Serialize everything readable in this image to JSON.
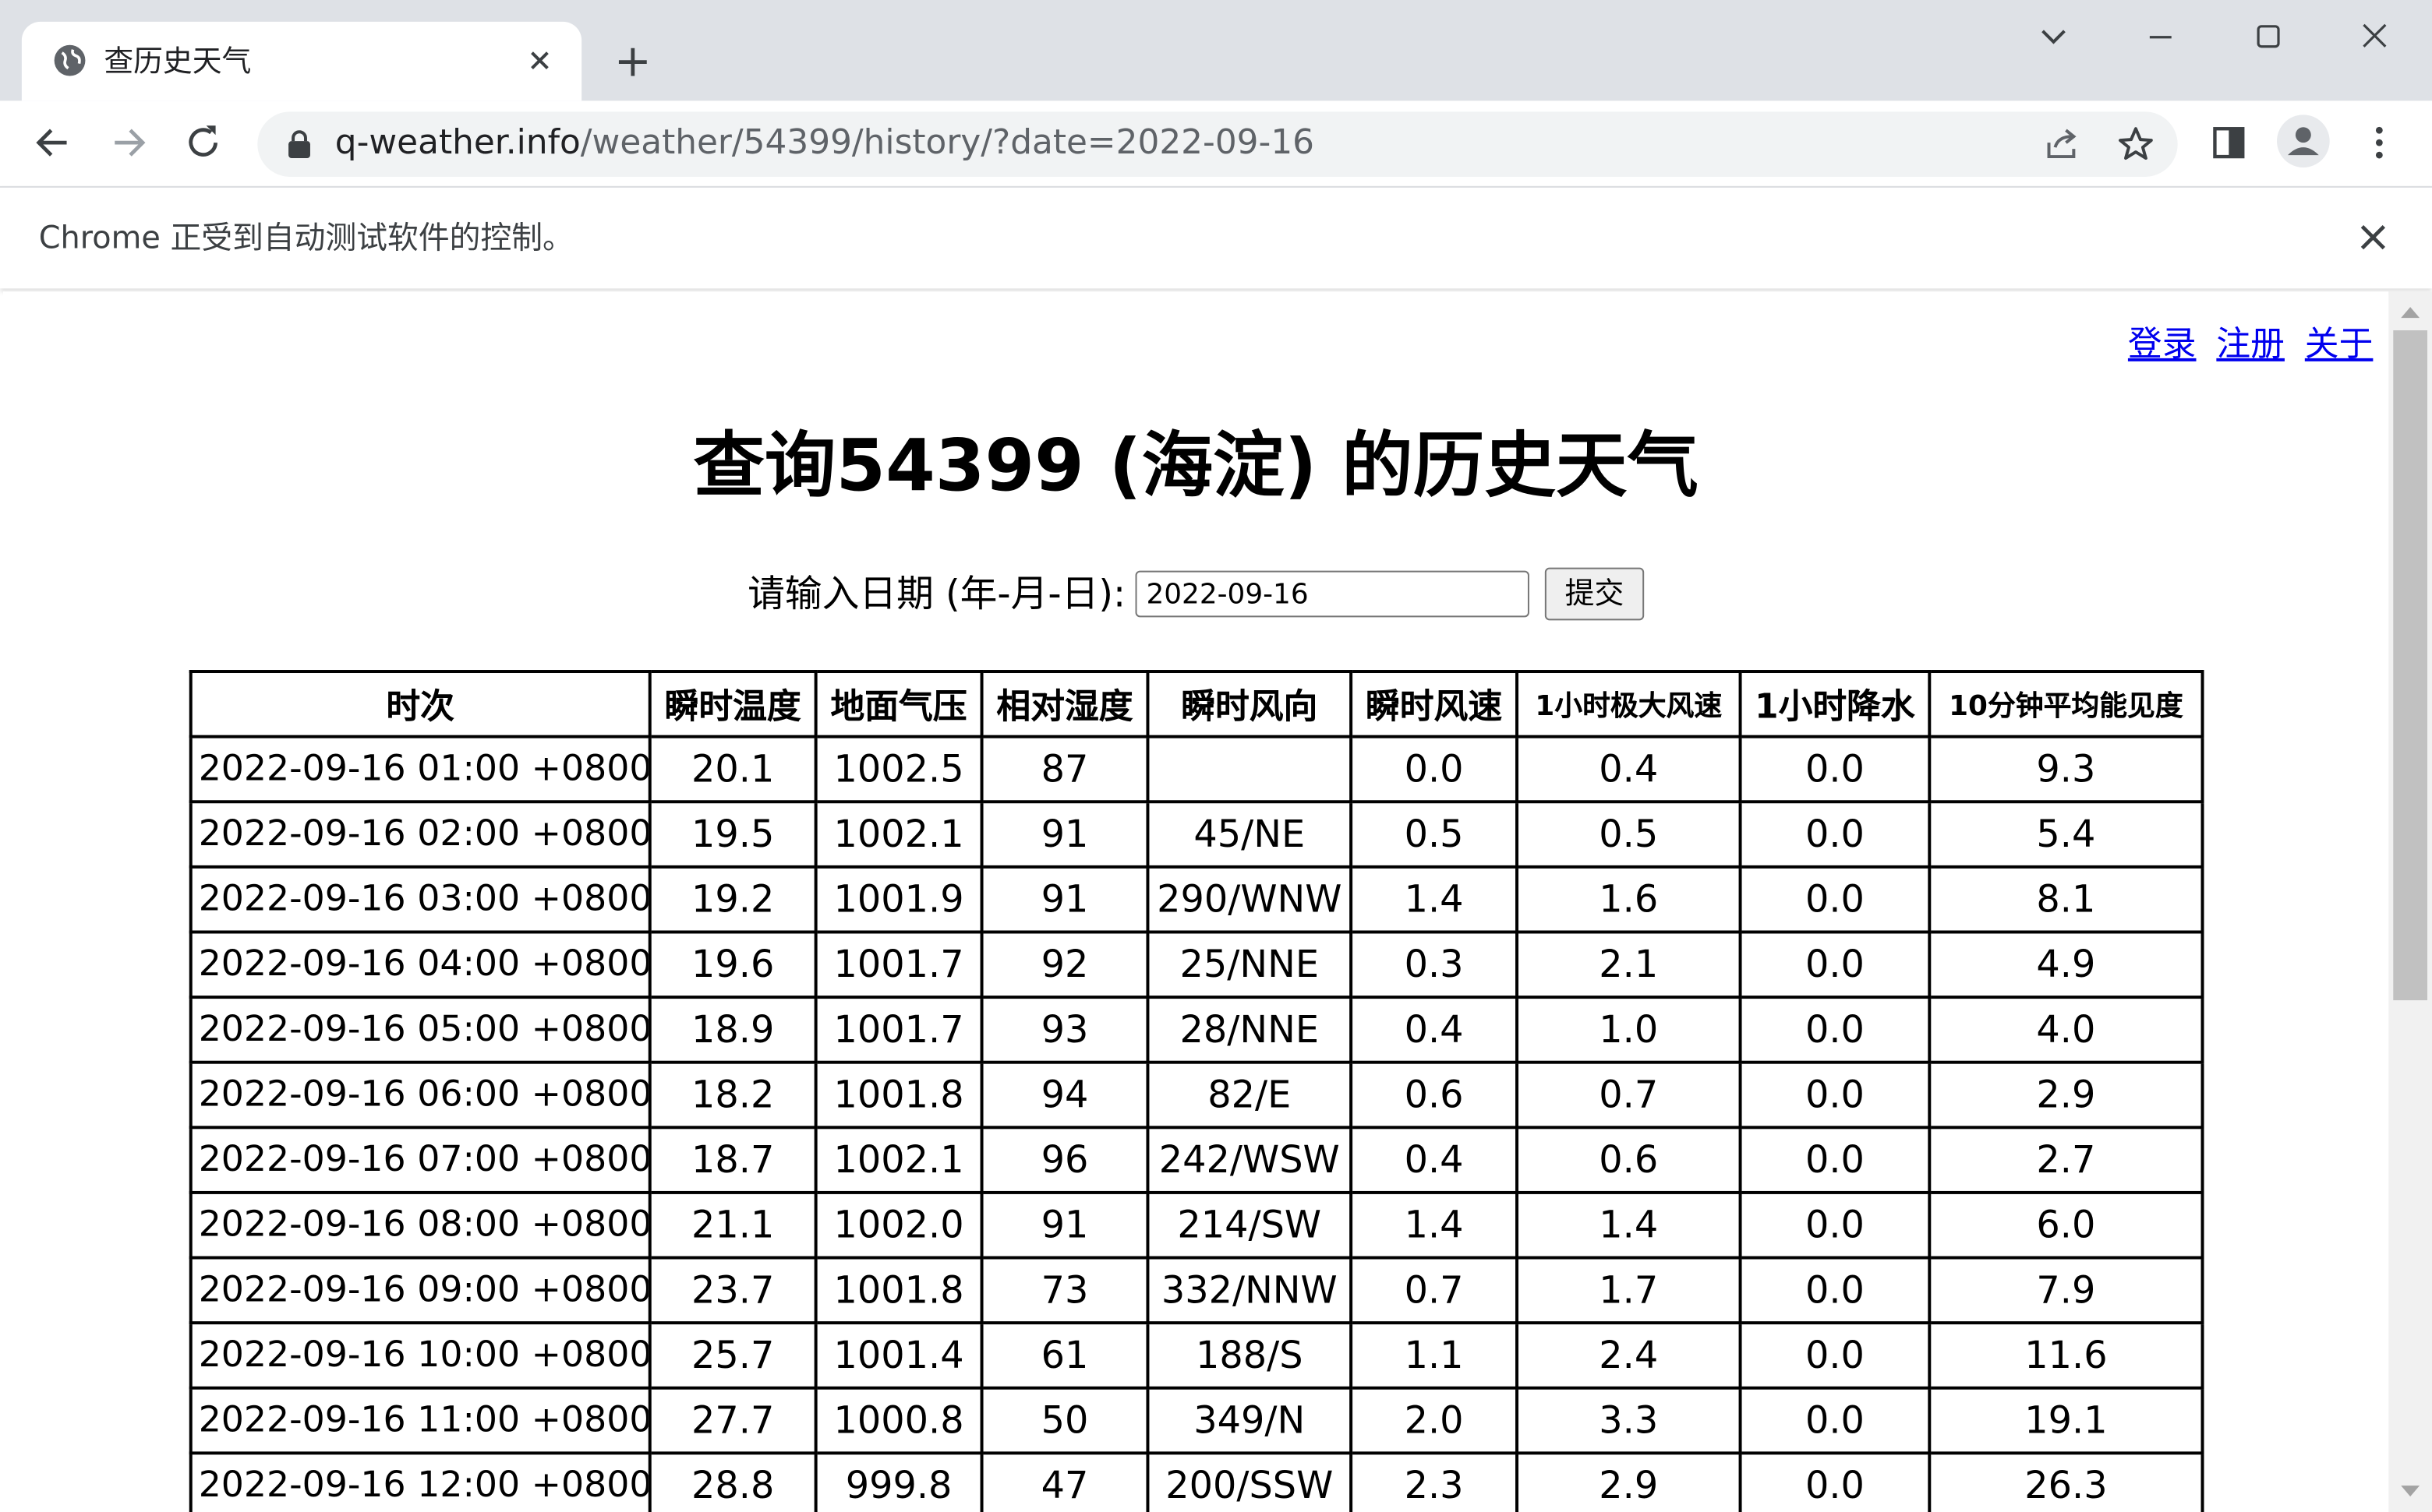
{
  "browser": {
    "tab_title": "查历史天气",
    "url_host": "q-weather.info",
    "url_path": "/weather/54399/history/?date=2022-09-16",
    "infobar_text": "Chrome 正受到自动测试软件的控制。"
  },
  "page": {
    "links": {
      "login": "登录",
      "register": "注册",
      "about": "关于"
    },
    "title": "查询54399 (海淀) 的历史天气",
    "form": {
      "label": "请输入日期 (年-月-日):",
      "date_value": "2022-09-16",
      "submit_label": "提交"
    },
    "table": {
      "headers": [
        "时次",
        "瞬时温度",
        "地面气压",
        "相对湿度",
        "瞬时风向",
        "瞬时风速",
        "1小时极大风速",
        "1小时降水",
        "10分钟平均能见度"
      ],
      "rows": [
        [
          "2022-09-16 01:00 +0800",
          "20.1",
          "1002.5",
          "87",
          "",
          "0.0",
          "0.4",
          "0.0",
          "9.3"
        ],
        [
          "2022-09-16 02:00 +0800",
          "19.5",
          "1002.1",
          "91",
          "45/NE",
          "0.5",
          "0.5",
          "0.0",
          "5.4"
        ],
        [
          "2022-09-16 03:00 +0800",
          "19.2",
          "1001.9",
          "91",
          "290/WNW",
          "1.4",
          "1.6",
          "0.0",
          "8.1"
        ],
        [
          "2022-09-16 04:00 +0800",
          "19.6",
          "1001.7",
          "92",
          "25/NNE",
          "0.3",
          "2.1",
          "0.0",
          "4.9"
        ],
        [
          "2022-09-16 05:00 +0800",
          "18.9",
          "1001.7",
          "93",
          "28/NNE",
          "0.4",
          "1.0",
          "0.0",
          "4.0"
        ],
        [
          "2022-09-16 06:00 +0800",
          "18.2",
          "1001.8",
          "94",
          "82/E",
          "0.6",
          "0.7",
          "0.0",
          "2.9"
        ],
        [
          "2022-09-16 07:00 +0800",
          "18.7",
          "1002.1",
          "96",
          "242/WSW",
          "0.4",
          "0.6",
          "0.0",
          "2.7"
        ],
        [
          "2022-09-16 08:00 +0800",
          "21.1",
          "1002.0",
          "91",
          "214/SW",
          "1.4",
          "1.4",
          "0.0",
          "6.0"
        ],
        [
          "2022-09-16 09:00 +0800",
          "23.7",
          "1001.8",
          "73",
          "332/NNW",
          "0.7",
          "1.7",
          "0.0",
          "7.9"
        ],
        [
          "2022-09-16 10:00 +0800",
          "25.7",
          "1001.4",
          "61",
          "188/S",
          "1.1",
          "2.4",
          "0.0",
          "11.6"
        ],
        [
          "2022-09-16 11:00 +0800",
          "27.7",
          "1000.8",
          "50",
          "349/N",
          "2.0",
          "3.3",
          "0.0",
          "19.1"
        ],
        [
          "2022-09-16 12:00 +0800",
          "28.8",
          "999.8",
          "47",
          "200/SSW",
          "2.3",
          "2.9",
          "0.0",
          "26.3"
        ]
      ]
    }
  },
  "colors": {
    "tabstrip": "#dee1e6",
    "omnibox": "#f1f3f4",
    "link": "#0000ee"
  }
}
